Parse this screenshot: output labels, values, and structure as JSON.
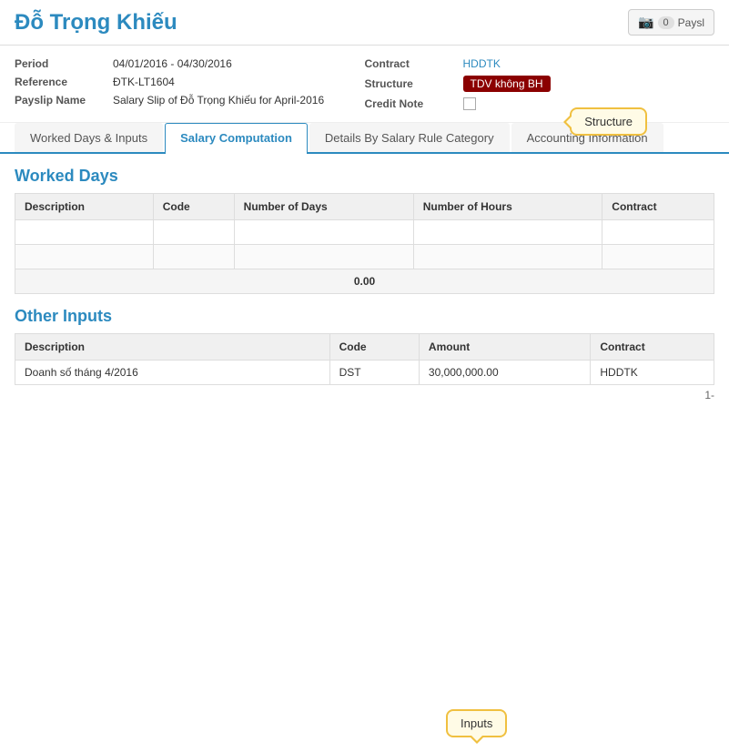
{
  "header": {
    "employee_name": "Đỗ Trọng Khiếu",
    "payslip_btn_label": "Paysl",
    "payslip_count": "0"
  },
  "info": {
    "period_label": "Period",
    "period_value": "04/01/2016 - 04/30/2016",
    "reference_label": "Reference",
    "reference_value": "ĐTK-LT1604",
    "payslip_name_label": "Payslip Name",
    "payslip_name_value": "Salary Slip of Đỗ Trọng Khiếu for April-2016",
    "contract_label": "Contract",
    "contract_value": "HDDTK",
    "structure_label": "Structure",
    "structure_value": "TDV không BH",
    "credit_note_label": "Credit Note"
  },
  "tooltip_structure": "Structure",
  "tooltip_inputs": "Inputs",
  "tabs": [
    {
      "label": "Worked Days & Inputs",
      "active": false
    },
    {
      "label": "Salary Computation",
      "active": true
    },
    {
      "label": "Details By Salary Rule Category",
      "active": false
    },
    {
      "label": "Accounting Information",
      "active": false
    }
  ],
  "worked_days": {
    "section_title": "Worked Days",
    "columns": [
      "Description",
      "Code",
      "Number of Days",
      "Number of Hours",
      "Contract"
    ],
    "rows": [],
    "total": "0.00"
  },
  "other_inputs": {
    "section_title": "Other Inputs",
    "columns": [
      "Description",
      "Code",
      "Amount",
      "Contract"
    ],
    "rows": [
      {
        "description": "Doanh số tháng 4/2016",
        "code": "DST",
        "amount": "30,000,000.00",
        "contract": "HDDTK"
      }
    ],
    "page_indicator": "1-"
  }
}
